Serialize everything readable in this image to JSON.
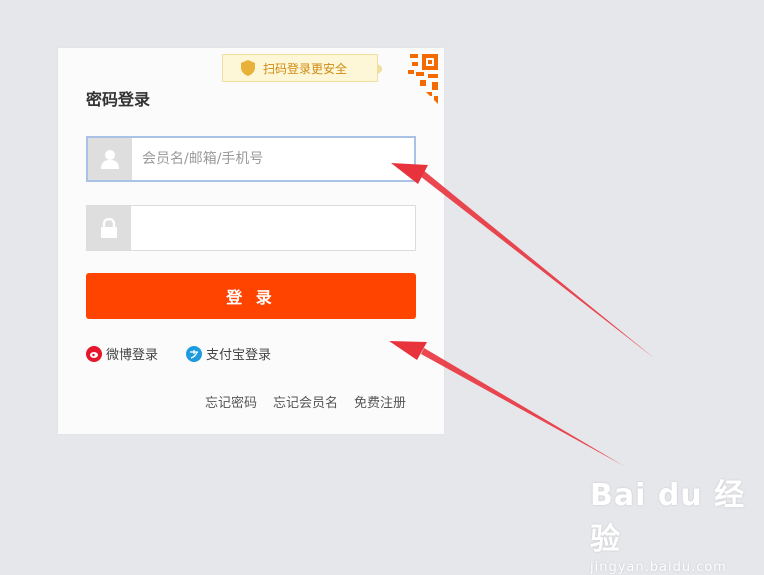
{
  "login": {
    "title": "密码登录",
    "qr_tip": "扫码登录更安全",
    "username_placeholder": "会员名/邮箱/手机号",
    "password_value": "",
    "submit_label": "登 录",
    "third_party": [
      {
        "label": "微博登录",
        "icon": "weibo-icon",
        "color": "#e6162d"
      },
      {
        "label": "支付宝登录",
        "icon": "alipay-icon",
        "color": "#1e9bde"
      }
    ],
    "links": [
      "忘记密码",
      "忘记会员名",
      "免费注册"
    ]
  },
  "colors": {
    "accent": "#ff4400",
    "background": "#e6e7eb",
    "arrow": "#e8333d",
    "qr_orange": "#f56a00"
  },
  "watermark": {
    "brand": "Bai du 经验",
    "url": "jingyan.baidu.com"
  }
}
